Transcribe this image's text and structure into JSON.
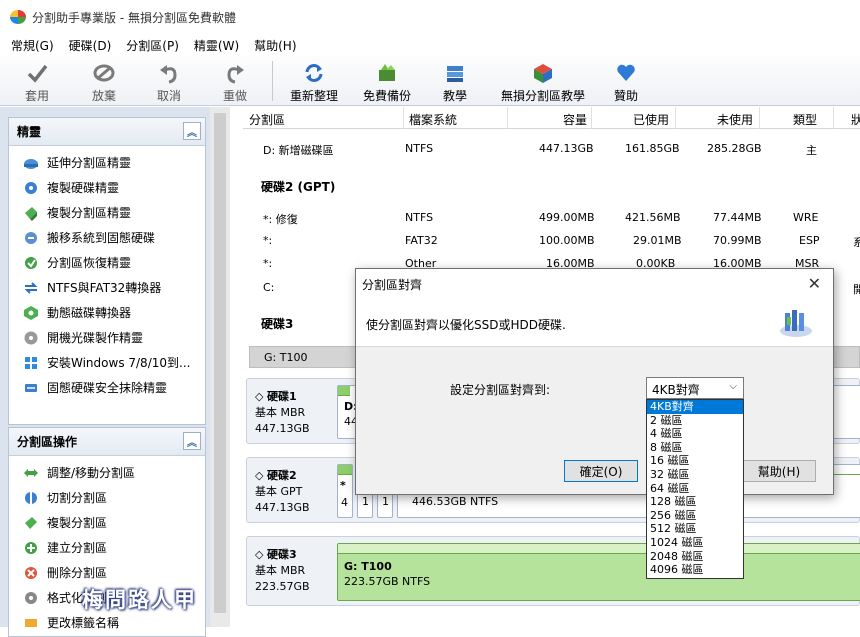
{
  "window": {
    "title": "分割助手專業版 - 無損分割區免費軟體"
  },
  "menu": [
    "常規(G)",
    "硬碟(D)",
    "分割區(P)",
    "精靈(W)",
    "幫助(H)"
  ],
  "toolbar": [
    {
      "label": "套用",
      "icon": "check-icon"
    },
    {
      "label": "放棄",
      "icon": "discard-icon"
    },
    {
      "label": "取消",
      "icon": "undo-icon"
    },
    {
      "label": "重做",
      "icon": "redo-icon"
    },
    {
      "label": "重新整理",
      "icon": "refresh-icon"
    },
    {
      "label": "免費備份",
      "icon": "backup-icon"
    },
    {
      "label": "教學",
      "icon": "tutorial-icon"
    },
    {
      "label": "無損分割區教學",
      "icon": "partition-tutorial-icon"
    },
    {
      "label": "贊助",
      "icon": "heart-icon"
    }
  ],
  "sidebar": {
    "wizards": {
      "title": "精靈",
      "items": [
        "延伸分割區精靈",
        "複製硬碟精靈",
        "複製分割區精靈",
        "搬移系統到固態硬碟",
        "分割區恢復精靈",
        "NTFS與FAT32轉換器",
        "動態磁碟轉換器",
        "開機光碟製作精靈",
        "安裝Windows 7/8/10到...",
        "固態硬碟安全抹除精靈"
      ]
    },
    "ops": {
      "title": "分割區操作",
      "items": [
        "調整/移動分割區",
        "切割分割區",
        "複製分割區",
        "建立分割區",
        "刪除分割區",
        "格式化分割區",
        "更改標籤名稱"
      ]
    }
  },
  "table": {
    "headers": [
      "分割區",
      "檔案系統",
      "容量",
      "已使用",
      "未使用",
      "類型",
      "狀"
    ],
    "rows": [
      {
        "type": "row",
        "cells": [
          "D: 新增磁碟區",
          "NTFS",
          "447.13GB",
          "161.85GB",
          "285.28GB",
          "主",
          ""
        ]
      },
      {
        "type": "disk",
        "label": "硬碟2 (GPT)"
      },
      {
        "type": "row",
        "cells": [
          "*: 修復",
          "NTFS",
          "499.00MB",
          "421.56MB",
          "77.44MB",
          "WRE",
          ""
        ]
      },
      {
        "type": "row",
        "cells": [
          "*:",
          "FAT32",
          "100.00MB",
          "29.01MB",
          "70.99MB",
          "ESP",
          "系"
        ]
      },
      {
        "type": "row",
        "cells": [
          "*:",
          "Other",
          "16.00MB",
          "0.00KB",
          "16.00MB",
          "MSR",
          ""
        ]
      },
      {
        "type": "row",
        "cells": [
          "C:",
          "",
          "",
          "",
          "",
          "",
          "開"
        ]
      },
      {
        "type": "disk",
        "label": "硬碟3"
      }
    ],
    "selected_row": "G: T100"
  },
  "disks": [
    {
      "name": "硬碟1",
      "style": "基本 MBR",
      "size": "447.13GB",
      "part_label": "D:",
      "part_detail": "44"
    },
    {
      "name": "硬碟2",
      "style": "基本 GPT",
      "size": "447.13GB",
      "part_label": "*",
      "part_nums": [
        "4",
        "1",
        "1"
      ],
      "part_detail": "446.53GB NTFS"
    },
    {
      "name": "硬碟3",
      "style": "基本 MBR",
      "size": "223.57GB",
      "part_label": "G: T100",
      "part_detail": "223.57GB NTFS"
    }
  ],
  "dialog": {
    "title": "分割區對齊",
    "close": "✕",
    "message": "使分割區對齊以優化SSD或HDD硬碟.",
    "label": "設定分割區對齊到:",
    "selected": "4KB對齊",
    "options": [
      "4KB對齊",
      "2 磁區",
      "4 磁區",
      "8 磁區",
      "16 磁區",
      "32 磁區",
      "64 磁區",
      "128 磁區",
      "256 磁區",
      "512 磁區",
      "1024 磁區",
      "2048 磁區",
      "4096 磁區"
    ],
    "ok": "確定(O)",
    "help": "幫助(H)"
  },
  "watermark": "梅問路人甲"
}
